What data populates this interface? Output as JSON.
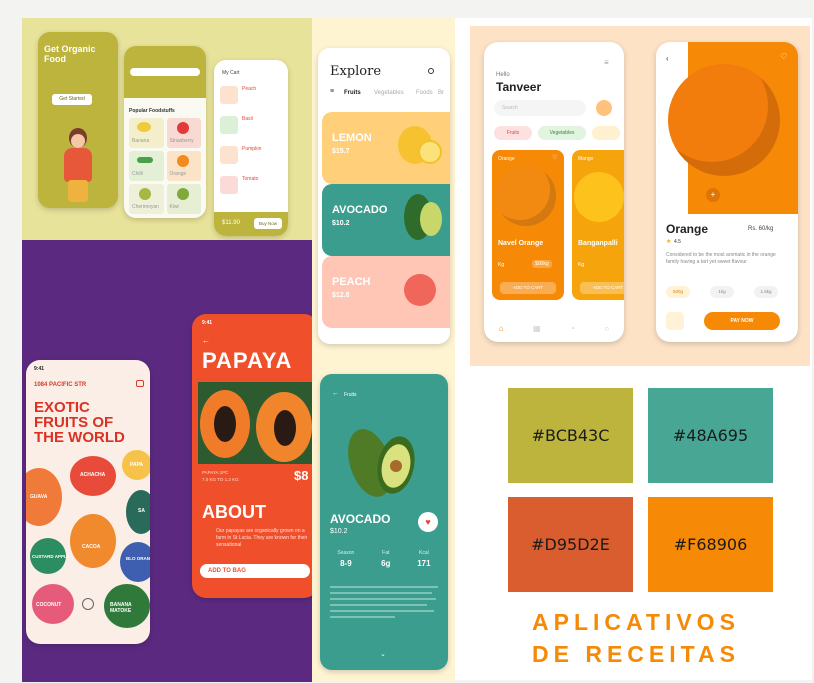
{
  "yellow_panel": {
    "onboarding": {
      "title": "Get Organic Food",
      "button": "Get Started"
    },
    "home": {
      "section": "Popular Foodstuffs",
      "items": [
        "Banana",
        "Strawberry",
        "Chilli",
        "Orange",
        "Cherimoyan",
        "Kiwi"
      ]
    },
    "cart": {
      "title": "My Cart",
      "items": [
        "Peach",
        "Basil",
        "Pumpkin",
        "Tomato"
      ],
      "total": "$11.90",
      "button": "Buy Now"
    }
  },
  "explore": {
    "title": "Explore",
    "tabs": [
      "Fruits",
      "Vegetables",
      "Foods",
      "Br"
    ],
    "cards": [
      {
        "name": "LEMON",
        "price": "$15.7",
        "color": "#ffd27d"
      },
      {
        "name": "AVOCADO",
        "price": "$10.2",
        "color": "#3b9d8e"
      },
      {
        "name": "PEACH",
        "price": "$12.8",
        "color": "#ffc6b6"
      }
    ]
  },
  "avocado_detail": {
    "back": "Fruits",
    "name": "AVOCADO",
    "price": "$10.2",
    "stats": [
      {
        "label": "Season",
        "value": "8-9"
      },
      {
        "label": "Fat",
        "value": "6g"
      },
      {
        "label": "Kcal",
        "value": "171"
      }
    ]
  },
  "exotic": {
    "time": "9:41",
    "address": "1084 PACIFIC STR",
    "headline": "EXOTIC FRUITS OF THE WORLD",
    "fruits": [
      "GUAVA",
      "ACHACHA",
      "PAPA",
      "SA",
      "CUSTARD APPLE",
      "CACOA",
      "BLO ORAN",
      "COCONUT",
      "BANANA MATOKE"
    ]
  },
  "papaya": {
    "time": "9:41",
    "title": "PAPAYA",
    "sub1": "PAPAYA 1PC",
    "sub2": "7.0 KG TO 1.2 KG",
    "price": "$8",
    "about": "ABOUT",
    "desc": "Our papayas are organically grown on a farm in St Lucia. They are known for their sensational",
    "button": "ADD TO BAG"
  },
  "orange_app": {
    "hello": "Hello",
    "user": "Tanveer",
    "search_placeholder": "Search",
    "categories": [
      "Fruits",
      "Vegetables"
    ],
    "cards": [
      {
        "tag": "Orange",
        "name": "Navel Orange",
        "qty": "Kg",
        "price": "$00kg",
        "button": "ADD TO CART"
      },
      {
        "tag": "Mango",
        "name": "Banganpalli",
        "qty": "Kg",
        "price": "$00kg",
        "button": "ADD TO CART"
      }
    ],
    "detail": {
      "name": "Orange",
      "price": "Rs. 60/kg",
      "rating": "4.5",
      "desc": "Considered to be the most aromatic in the orange family having a tart yet sweet flavour",
      "weights": [
        "500g",
        "1kg",
        "1.5kg"
      ],
      "button": "PAY NOW"
    }
  },
  "palette": {
    "swatches": [
      {
        "hex": "#BCB43C",
        "color": "#BCB43C"
      },
      {
        "hex": "#48A695",
        "color": "#48A695"
      },
      {
        "hex": "#D95D2E",
        "color": "#D95D2E"
      },
      {
        "hex": "#F68906",
        "color": "#F68906"
      }
    ]
  },
  "caption": {
    "line1": "APLICATIVOS",
    "line2": "DE RECEITAS",
    "color": "#F68906"
  }
}
